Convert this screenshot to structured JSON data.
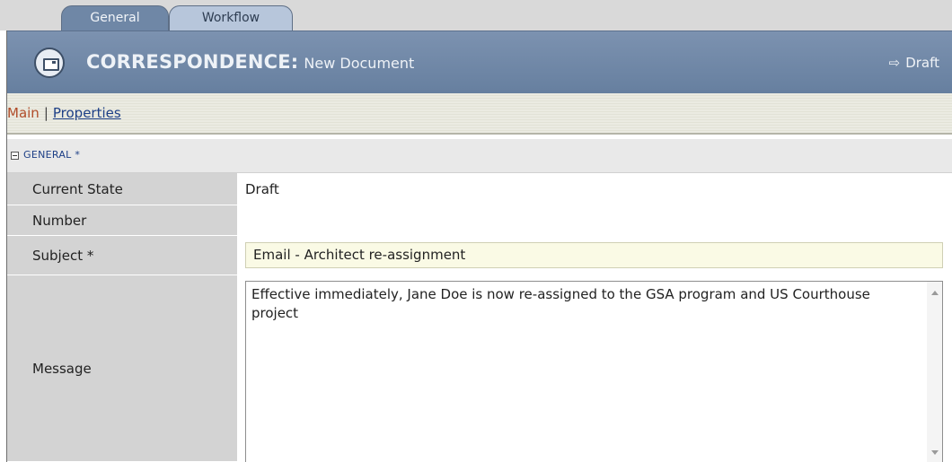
{
  "tabs": [
    {
      "label": "General",
      "active": true
    },
    {
      "label": "Workflow",
      "active": false
    }
  ],
  "header": {
    "type_label": "CORRESPONDENCE:",
    "doc_name": "New Document",
    "state_icon": "arrow-right-icon",
    "state": "Draft",
    "bg_color": "#6f87a6"
  },
  "subnav": {
    "main": "Main",
    "separator": "|",
    "properties": "Properties"
  },
  "section": {
    "label": "GENERAL *"
  },
  "fields": {
    "current_state": {
      "label": "Current State",
      "value": "Draft"
    },
    "number": {
      "label": "Number",
      "value": ""
    },
    "subject": {
      "label": "Subject *",
      "value": "Email - Architect re-assignment"
    },
    "message": {
      "label": "Message",
      "value": "Effective immediately, Jane Doe is now re-assigned to the GSA program and US Courthouse project"
    }
  }
}
